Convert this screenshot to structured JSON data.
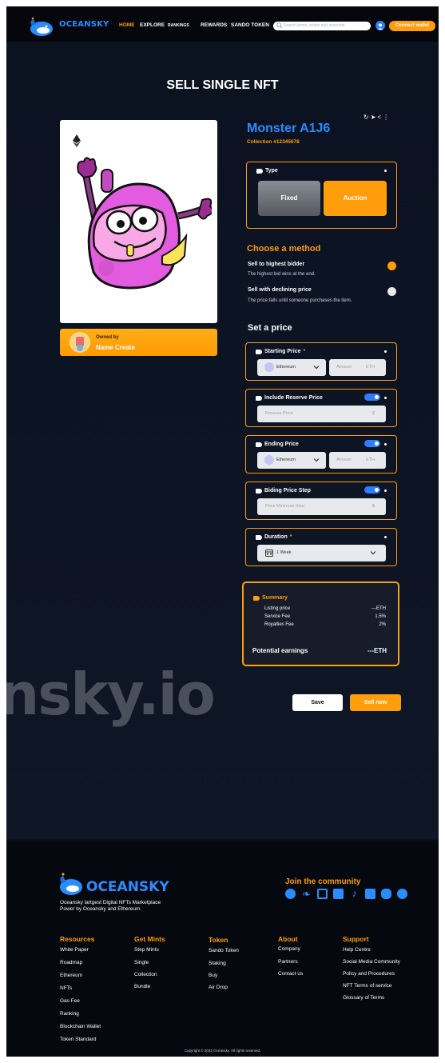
{
  "header": {
    "brand": "OCEANSKY",
    "nav": [
      "HOME",
      "EXPLORE",
      "RANKINGS",
      "REWARDS",
      "SANDO TOKEN"
    ],
    "search_placeholder": "Search items, artists and accounts",
    "connect_label": "Connect wallet"
  },
  "page": {
    "title": "SELL SINGLE NFT"
  },
  "nft": {
    "name": "Monster A1J6",
    "collection": "Collection #12345678",
    "owned_by_label": "Owned by",
    "owner_name": "Name Create"
  },
  "type_box": {
    "label": "Type",
    "fixed_label": "Fixed",
    "auction_label": "Auction",
    "selected": "Auction"
  },
  "method": {
    "heading": "Choose a method",
    "options": [
      {
        "title": "Sell to highest bidder",
        "desc": "The highest bid wins at the end.",
        "selected": true
      },
      {
        "title": "Sell with declining price",
        "desc": "The price falls until someone purchases the item.",
        "selected": false
      }
    ]
  },
  "price": {
    "heading": "Set a price",
    "starting": {
      "label": "Starting Price",
      "required_mark": "*",
      "currency": "Ethereum",
      "amount_placeholder": "Amount",
      "unit": "ETH"
    },
    "reserve": {
      "label": "Include Reserve Price",
      "placeholder": "Reserve Price",
      "unit": "$",
      "toggle_on": true
    },
    "ending": {
      "label": "Ending Price",
      "currency": "Ethereum",
      "amount_placeholder": "Amount",
      "unit": "ETH",
      "toggle_on": true
    },
    "step": {
      "label": "Biding Price Step",
      "placeholder": "Price Minimum Step",
      "unit": "$",
      "toggle_on": true
    },
    "duration": {
      "label": "Duration",
      "required_mark": "*",
      "value": "1 Week"
    }
  },
  "summary": {
    "heading": "Summary",
    "rows": [
      {
        "label": "Listing price",
        "value": "---ETH"
      },
      {
        "label": "Service Fee",
        "value": "1.5%"
      },
      {
        "label": "Royalties Fee",
        "value": "2%"
      }
    ],
    "potential_label": "Potential earnings",
    "potential_value": "---ETH"
  },
  "actions": {
    "save_label": "Save",
    "sell_label": "Sell now"
  },
  "watermark": "nsky.io",
  "footer": {
    "brand": "OCEANSKY",
    "desc_line1": "Oceansky lartgest Digital NFTs Marketplace",
    "desc_line2": "Power by Oceansky and Ethereum.",
    "join_label": "Join the community",
    "columns": [
      {
        "heading": "Resources",
        "items": [
          "White Paper",
          "Roadmap",
          "Ethereum",
          "NFTs",
          "Gas Fee",
          "Ranking",
          "Blockchain Wallet",
          "Token Standard"
        ]
      },
      {
        "heading": "Get Mints",
        "items": [
          "Step Mints",
          "Single",
          "Collection",
          "Bundle"
        ]
      },
      {
        "heading": "Token",
        "items": [
          "Sando Token",
          "Staking",
          "Buy",
          "Air Drop"
        ]
      },
      {
        "heading": "About",
        "items": [
          "Company",
          "Partners",
          "Contact us"
        ]
      },
      {
        "heading": "Support",
        "items": [
          "Help Centre",
          "Social Media Community",
          "Policy and Procedures",
          "NFT Terms of service",
          "Glossary of Terms"
        ]
      }
    ],
    "copyright": "Copyright © 2023 Oceansky. All rights reserved."
  },
  "colors": {
    "accent": "#ff9d0a",
    "brand_blue": "#2b8cff",
    "background": "#0b1220"
  }
}
